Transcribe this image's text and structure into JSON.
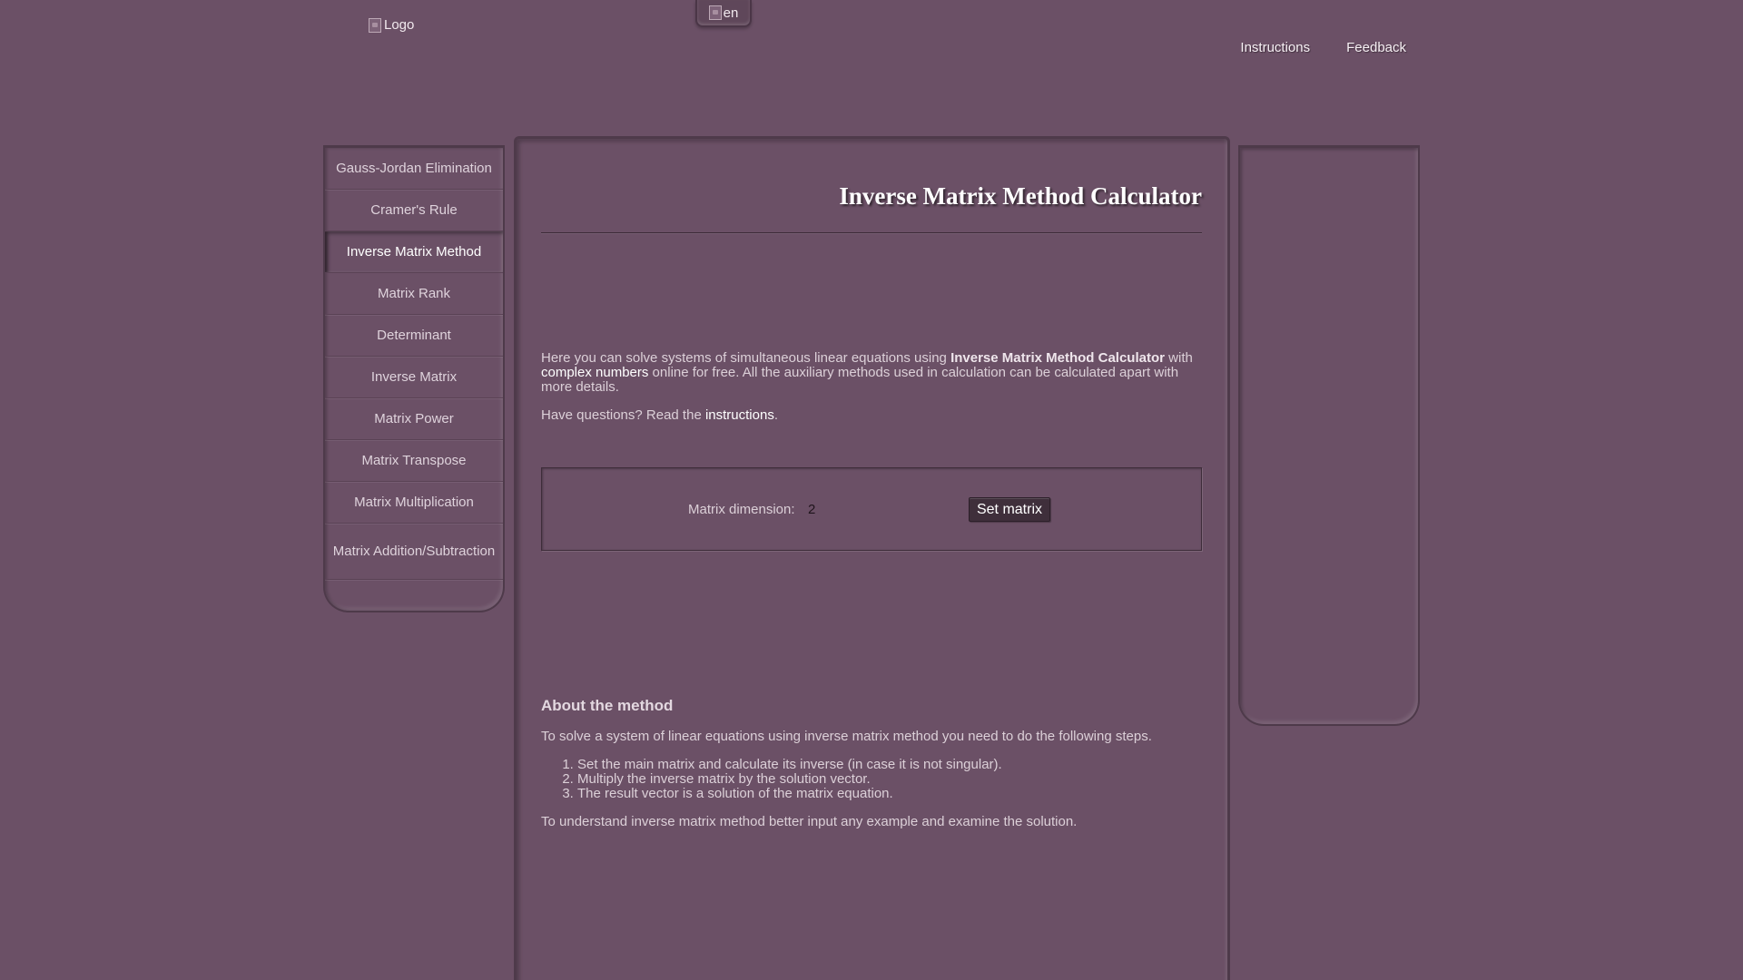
{
  "header": {
    "logo_alt": "Logo",
    "language_alt": "en",
    "nav": [
      {
        "label": "Instructions"
      },
      {
        "label": "Feedback"
      }
    ]
  },
  "menu": {
    "items": [
      {
        "label": "Gauss-Jordan Elimination"
      },
      {
        "label": "Cramer's Rule"
      },
      {
        "label": "Inverse Matrix Method",
        "active": true
      },
      {
        "label": "Matrix Rank"
      },
      {
        "label": "Determinant"
      },
      {
        "label": "Inverse Matrix"
      },
      {
        "label": "Matrix Power"
      },
      {
        "label": "Matrix Transpose"
      },
      {
        "label": "Matrix Multiplication"
      },
      {
        "label": "Matrix Addition/Subtraction"
      }
    ]
  },
  "main": {
    "title": "Inverse Matrix Method Calculator",
    "intro": {
      "part1": "Here you can solve systems of simultaneous linear equations using ",
      "bold": "Inverse Matrix Method Calculator",
      "part2": " with ",
      "link": "complex numbers",
      "part3": " online for free. All the auxiliary methods used in calculation can be calculated apart with more details."
    },
    "questions": {
      "text": "Have questions? Read the ",
      "link": "instructions",
      "end": "."
    },
    "matrix_form": {
      "label": "Matrix dimension:",
      "value": "2",
      "button": "Set matrix"
    },
    "about": {
      "heading": "About the method",
      "lead": "To solve a system of linear equations using inverse matrix method you need to do the following steps.",
      "steps": [
        "Set the main matrix and calculate its inverse (in case it is not singular).",
        "Multiply the inverse matrix by the solution vector.",
        "The result vector is a solution of the matrix equation."
      ],
      "outro": "To understand inverse matrix method better input any example and examine the solution."
    }
  },
  "colors": {
    "background": "#6b5066",
    "border": "#4e3a4a",
    "button": "#3f2f3b"
  }
}
